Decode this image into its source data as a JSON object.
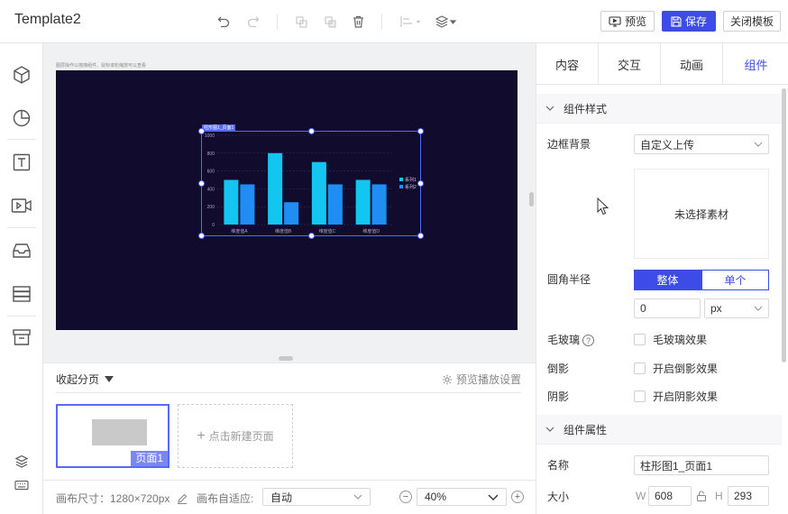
{
  "app": {
    "title": "Template2"
  },
  "toolbar": {
    "preview_label": "预览",
    "save_label": "保存",
    "close_template_label": "关闭模板",
    "icons": [
      "undo-icon",
      "redo-icon",
      "copy-icon",
      "paste-icon",
      "delete-icon",
      "align-icon",
      "layers-icon"
    ]
  },
  "left_sidebar": {
    "icons": [
      "cube-icon",
      "pie-chart-icon",
      "text-icon",
      "video-icon",
      "inbox-icon",
      "list-icon",
      "archive-icon",
      "layers-icon",
      "keyboard-icon"
    ]
  },
  "canvas": {
    "hint": "图层操作以拖拽组件，鼠标滚轮缩放可以查看",
    "selected_tag": "柱形图1_页面1",
    "background": "#110c2e"
  },
  "chart_data": {
    "type": "bar",
    "categories": [
      "维度值A",
      "维度值B",
      "维度值C",
      "维度值D"
    ],
    "series": [
      {
        "name": "系列1",
        "color": "#13c6f2",
        "values": [
          500,
          800,
          700,
          500
        ]
      },
      {
        "name": "系列2",
        "color": "#1e8ef5",
        "values": [
          450,
          250,
          450,
          450
        ]
      }
    ],
    "ylim": [
      0,
      1000
    ],
    "yticks": [
      "0",
      "200",
      "400",
      "600",
      "800",
      "1000"
    ],
    "legend_position": "right",
    "grid": true
  },
  "pages": {
    "collapse_label": "收起分页",
    "preview_settings_label": "预览播放设置",
    "page_label": "页面1",
    "new_page_label": "点击新建页面"
  },
  "footer": {
    "canvas_size": "画布尺寸：1280×720px",
    "adapt_label": "画布自适应:",
    "adapt_value": "自动",
    "zoom_value": "40%"
  },
  "right_panel": {
    "tabs": [
      "内容",
      "交互",
      "动画",
      "组件"
    ],
    "active_tab": "组件",
    "style_section": "组件样式",
    "border_bg_label": "边框背景",
    "border_bg_value": "自定义上传",
    "upload_placeholder": "未选择素材",
    "radius_label": "圆角半径",
    "radius_whole": "整体",
    "radius_single": "单个",
    "radius_value": "0",
    "radius_unit": "px",
    "glass_label": "毛玻璃",
    "glass_option": "毛玻璃效果",
    "reflection_label": "倒影",
    "reflection_option": "开启倒影效果",
    "shadow_label": "阴影",
    "shadow_option": "开启阴影效果",
    "props_section": "组件属性",
    "name_label": "名称",
    "name_value": "柱形图1_页面1",
    "size_label": "大小",
    "width_letter": "W",
    "width_value": "608",
    "height_letter": "H",
    "height_value": "293"
  }
}
